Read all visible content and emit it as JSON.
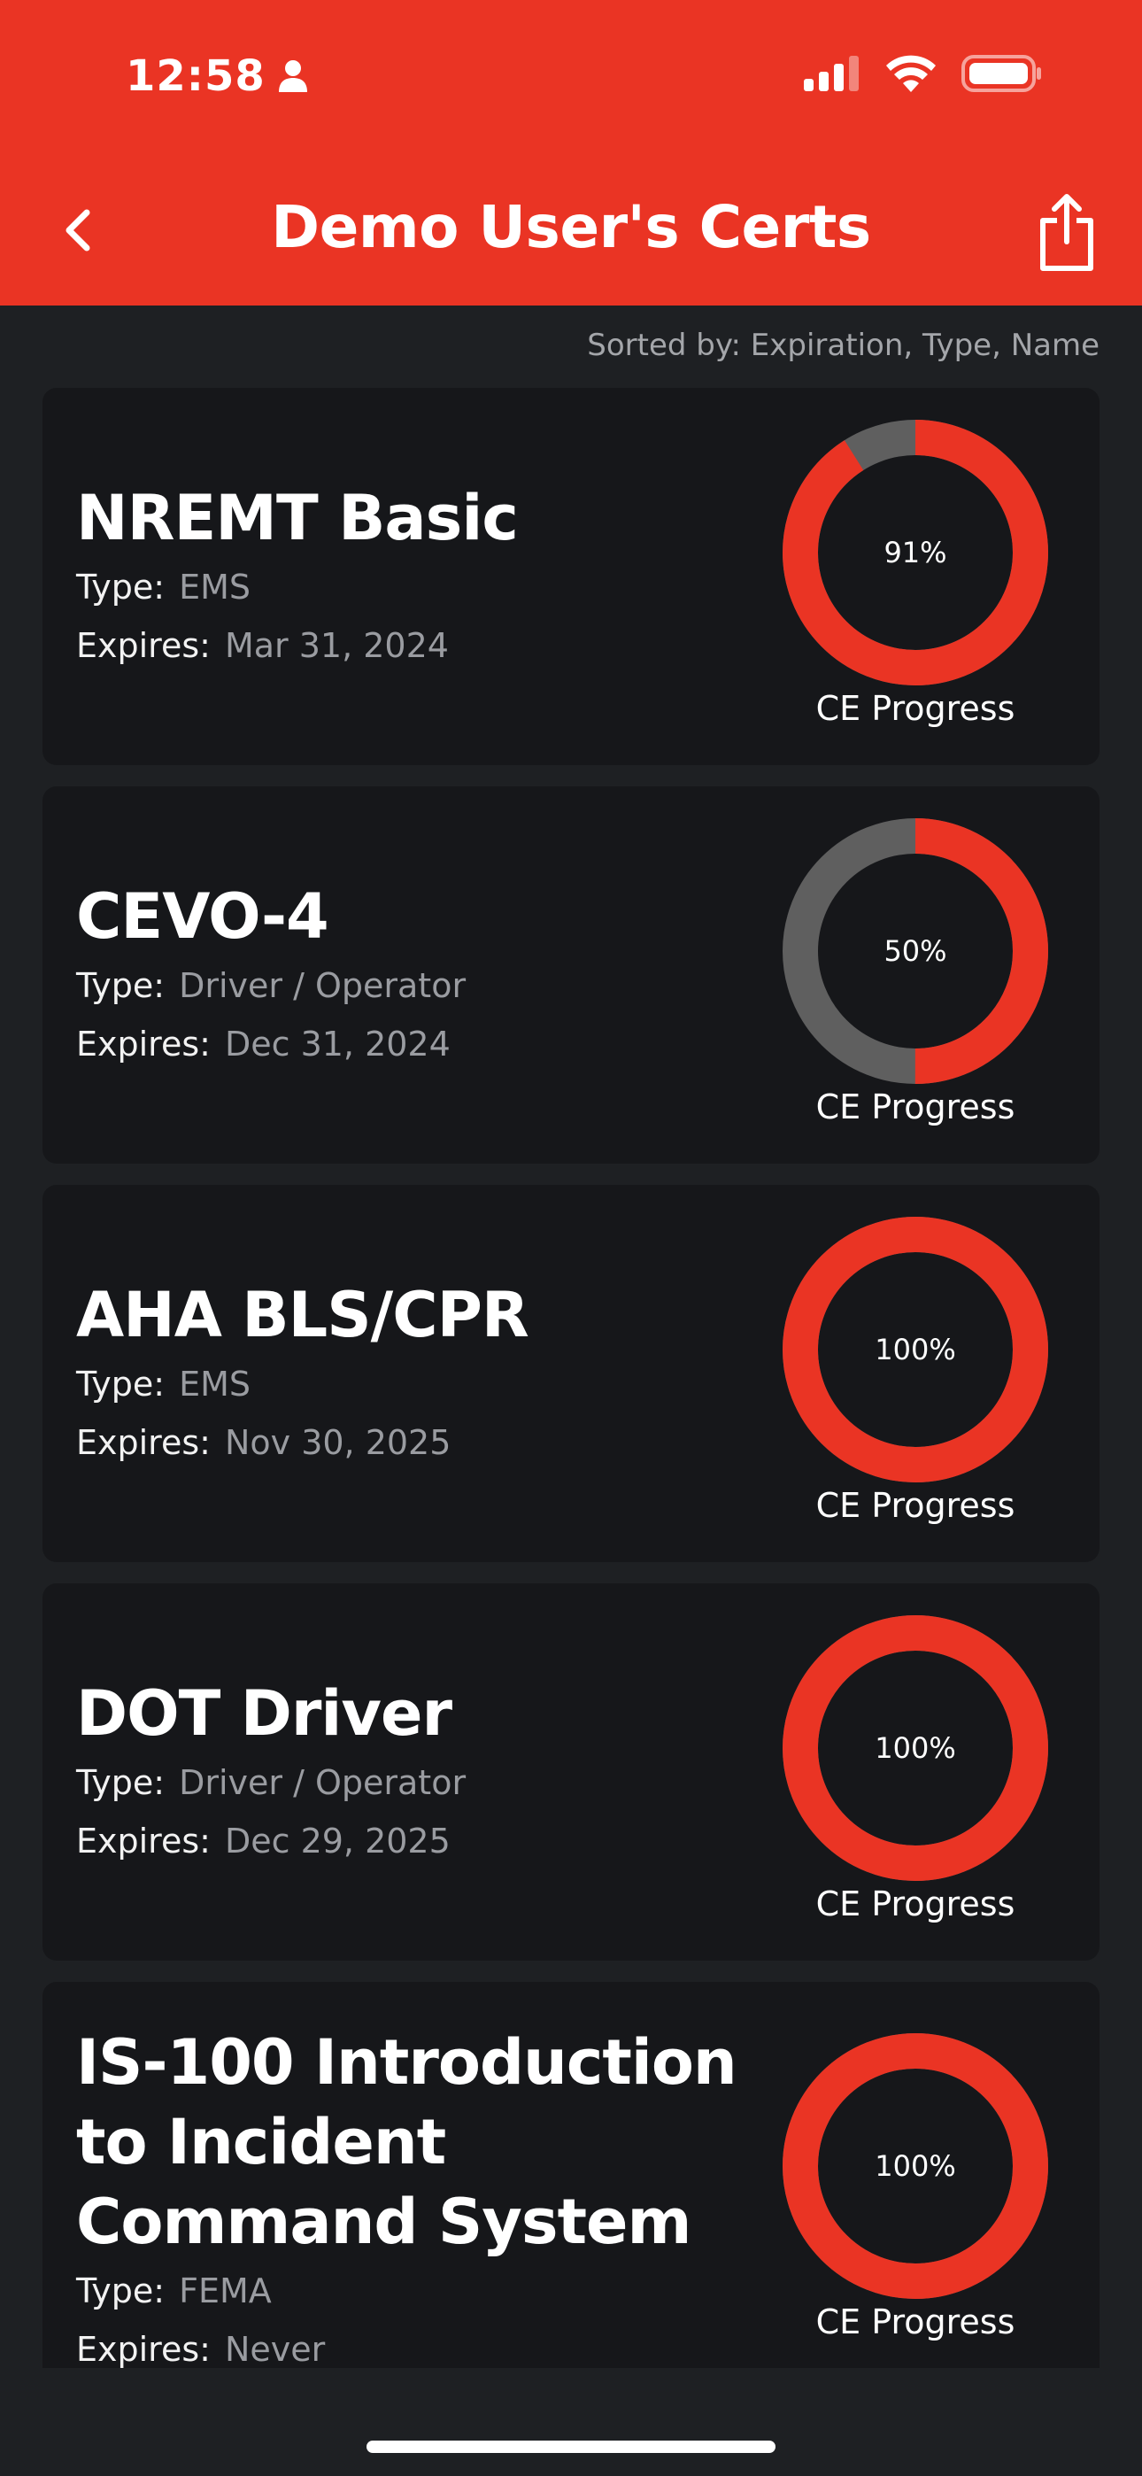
{
  "status_bar": {
    "time": "12:58"
  },
  "nav": {
    "title": "Demo User's Certs"
  },
  "sort_label": "Sorted by: Expiration, Type, Name",
  "colors": {
    "accent": "#ea3424",
    "track": "#5f5f5f",
    "background": "#1e2023",
    "card": "#16171a"
  },
  "certs": [
    {
      "name": "NREMT Basic",
      "type_key": "Type:",
      "type": "EMS",
      "expires_key": "Expires:",
      "expires": "Mar 31, 2024",
      "progress": 0.91,
      "progress_label": "91%",
      "caption": "CE Progress"
    },
    {
      "name": "CEVO-4",
      "type_key": "Type:",
      "type": "Driver / Operator",
      "expires_key": "Expires:",
      "expires": "Dec 31, 2024",
      "progress": 0.5,
      "progress_label": "50%",
      "caption": "CE Progress"
    },
    {
      "name": "AHA BLS/CPR",
      "type_key": "Type:",
      "type": "EMS",
      "expires_key": "Expires:",
      "expires": "Nov 30, 2025",
      "progress": 1.0,
      "progress_label": "100%",
      "caption": "CE Progress"
    },
    {
      "name": "DOT Driver",
      "type_key": "Type:",
      "type": "Driver / Operator",
      "expires_key": "Expires:",
      "expires": "Dec 29, 2025",
      "progress": 1.0,
      "progress_label": "100%",
      "caption": "CE Progress"
    },
    {
      "name": "IS-100 Introduction to Incident Command System",
      "type_key": "Type:",
      "type": "FEMA",
      "expires_key": "Expires:",
      "expires": "Never",
      "progress": 1.0,
      "progress_label": "100%",
      "caption": "CE Progress"
    }
  ]
}
